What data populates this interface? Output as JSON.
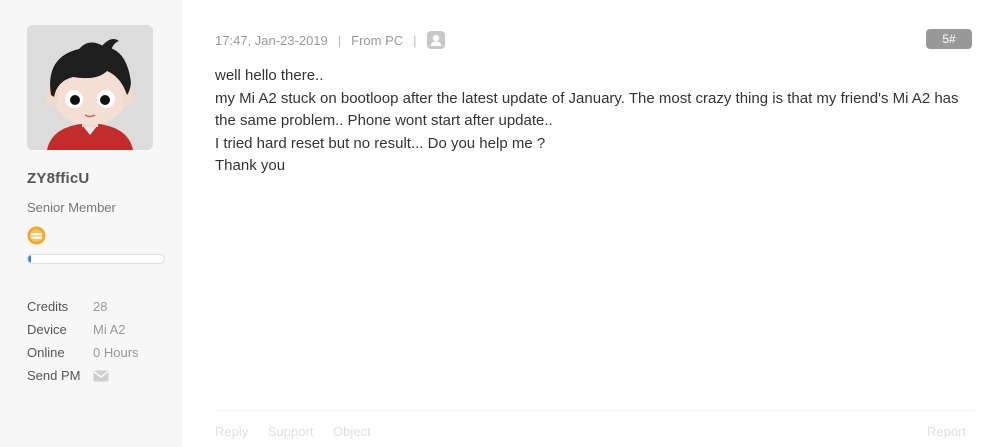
{
  "author": {
    "username": "ZY8fficU",
    "rank": "Senior Member",
    "level_progress": 0.02,
    "medal_icon": "medal-icon",
    "stats": [
      {
        "label": "Credits",
        "value": "28"
      },
      {
        "label": "Device",
        "value": "Mi A2"
      },
      {
        "label": "Online",
        "value": "0 Hours"
      },
      {
        "label": "Send PM",
        "icon": "envelope-icon"
      }
    ]
  },
  "post": {
    "timestamp": "17:47, Jan-23-2019",
    "separator": "|",
    "source": "From PC",
    "device_icon": "user-silhouette-icon",
    "floor": "5#",
    "lines": [
      "well hello there..",
      "my Mi A2 stuck on bootloop after the latest update of January. The most crazy thing is that my friend's Mi A2 has the same problem.. Phone wont start after update..",
      "I tried hard reset but no result...  Do you help me ?",
      "Thank you"
    ]
  },
  "actions": {
    "reply": "Reply",
    "support": "Support",
    "object": "Object",
    "report": "Report"
  },
  "colors": {
    "sidebar_bg": "#f7f7f7",
    "floor_badge": "#999999",
    "level_fill": "#2e8fd6",
    "avatar_shirt": "#c42b2b"
  }
}
